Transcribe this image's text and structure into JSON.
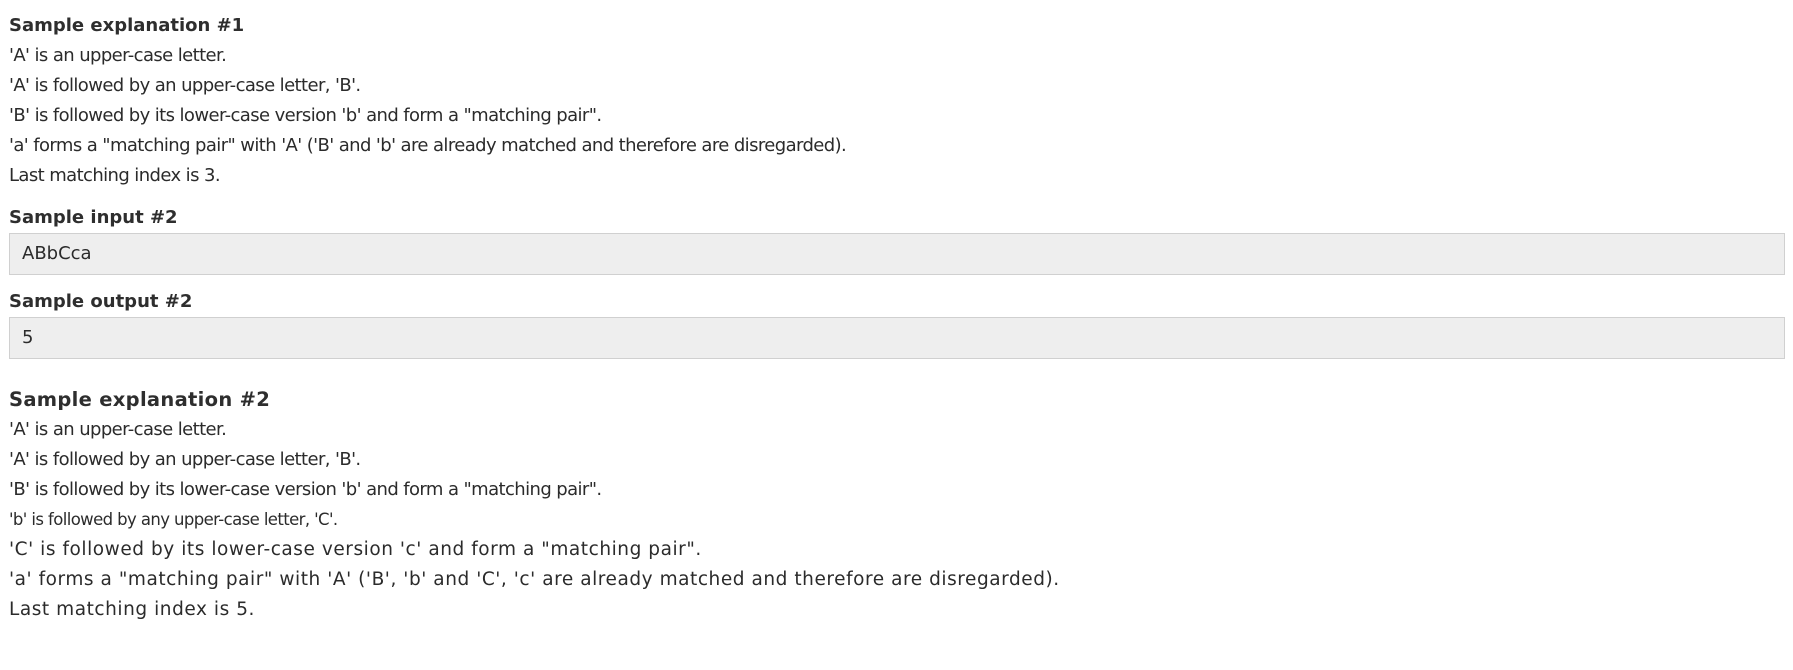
{
  "explanation1": {
    "title": "Sample explanation #1",
    "lines": [
      "'A' is an upper-case letter.",
      "'A' is followed by an upper-case letter, 'B'.",
      "'B' is followed by its lower-case version 'b' and form a \"matching pair\".",
      "'a' forms a \"matching pair\" with 'A' ('B' and 'b' are already matched and therefore are disregarded).",
      "Last matching index is 3."
    ]
  },
  "input2": {
    "title": "Sample input #2",
    "value": "ABbCca"
  },
  "output2": {
    "title": "Sample output #2",
    "value": "5"
  },
  "explanation2": {
    "title": "Sample explanation #2",
    "lines": [
      "'A' is an upper-case letter.",
      "'A' is followed by an upper-case letter, 'B'.",
      "'B' is followed by its lower-case version 'b' and form a \"matching pair\".",
      "'b' is followed by any upper-case letter, 'C'.",
      "'C' is followed by its lower-case version 'c' and form a \"matching pair\".",
      "'a' forms a \"matching pair\" with 'A' ('B', 'b' and 'C', 'c' are already matched and therefore are disregarded).",
      "Last matching index is 5."
    ]
  }
}
